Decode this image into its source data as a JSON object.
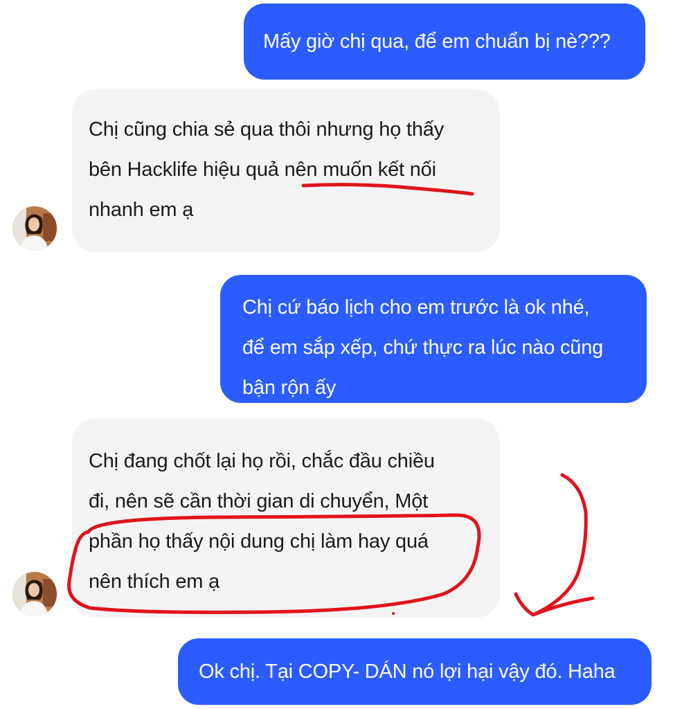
{
  "conversation": {
    "messages": [
      {
        "sender": "me",
        "lines": [
          "Mấy giờ chị qua, để em chuẩn bị nè???"
        ]
      },
      {
        "sender": "contact",
        "lines": [
          "Chị cũng chia sẻ qua thôi nhưng họ thấy",
          "bên Hacklife hiệu quả nên muốn kết nối",
          "nhanh em ạ"
        ]
      },
      {
        "sender": "me",
        "lines": [
          "Chị cứ báo lịch cho em trước là ok nhé,",
          "để em sắp xếp, chứ thực ra lúc nào cũng",
          "bận rộn ấy"
        ]
      },
      {
        "sender": "contact",
        "lines": [
          "Chị đang chốt lại họ rồi, chắc đầu chiều",
          "đi, nên sẽ cần thời gian di chuyển, Một",
          "phần họ thấy nội dung chị làm hay quá",
          "nên thích em ạ"
        ]
      },
      {
        "sender": "me",
        "lines": [
          "Ok chị. Tại COPY- DÁN nó lợi hại vậy đó. Haha"
        ]
      }
    ]
  },
  "colors": {
    "sent_bubble": "#2b5cff",
    "received_bubble": "#f4f4f4",
    "annotation": "#e0141b"
  },
  "icons": {
    "contact_avatar": "avatar",
    "annotation_arrow": "arrow-down-left-icon"
  }
}
